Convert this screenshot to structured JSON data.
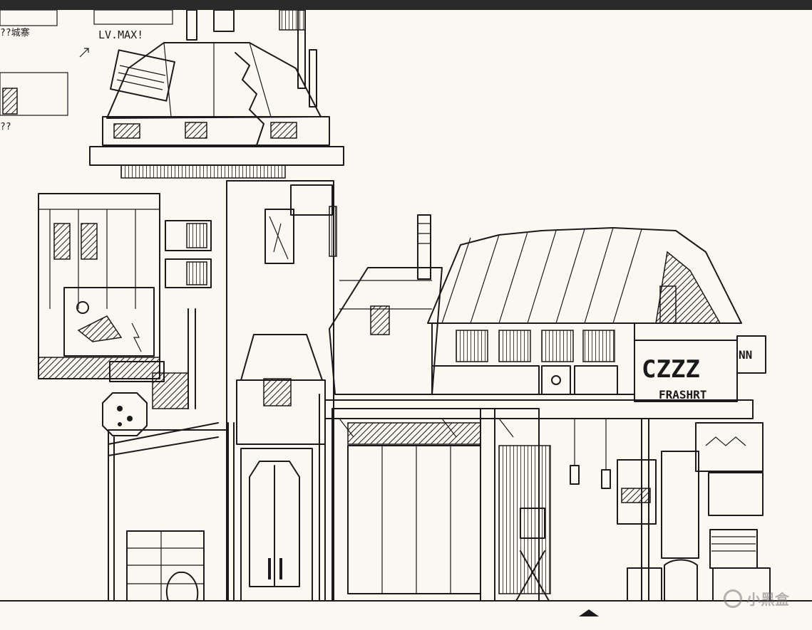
{
  "sketch": {
    "top_note": "LV.MAX!",
    "side_note_left": "??城寨",
    "side_note_left_2": "??",
    "shop_sign": "CZZZ",
    "shop_sign_sub": "FRASHRT",
    "edge_sign": "NN"
  },
  "watermark": {
    "text": "小黑盒"
  },
  "colors": {
    "paper": "#fbf7f1",
    "ink": "#1a1a1a",
    "top_bar": "#2a2a2a"
  }
}
